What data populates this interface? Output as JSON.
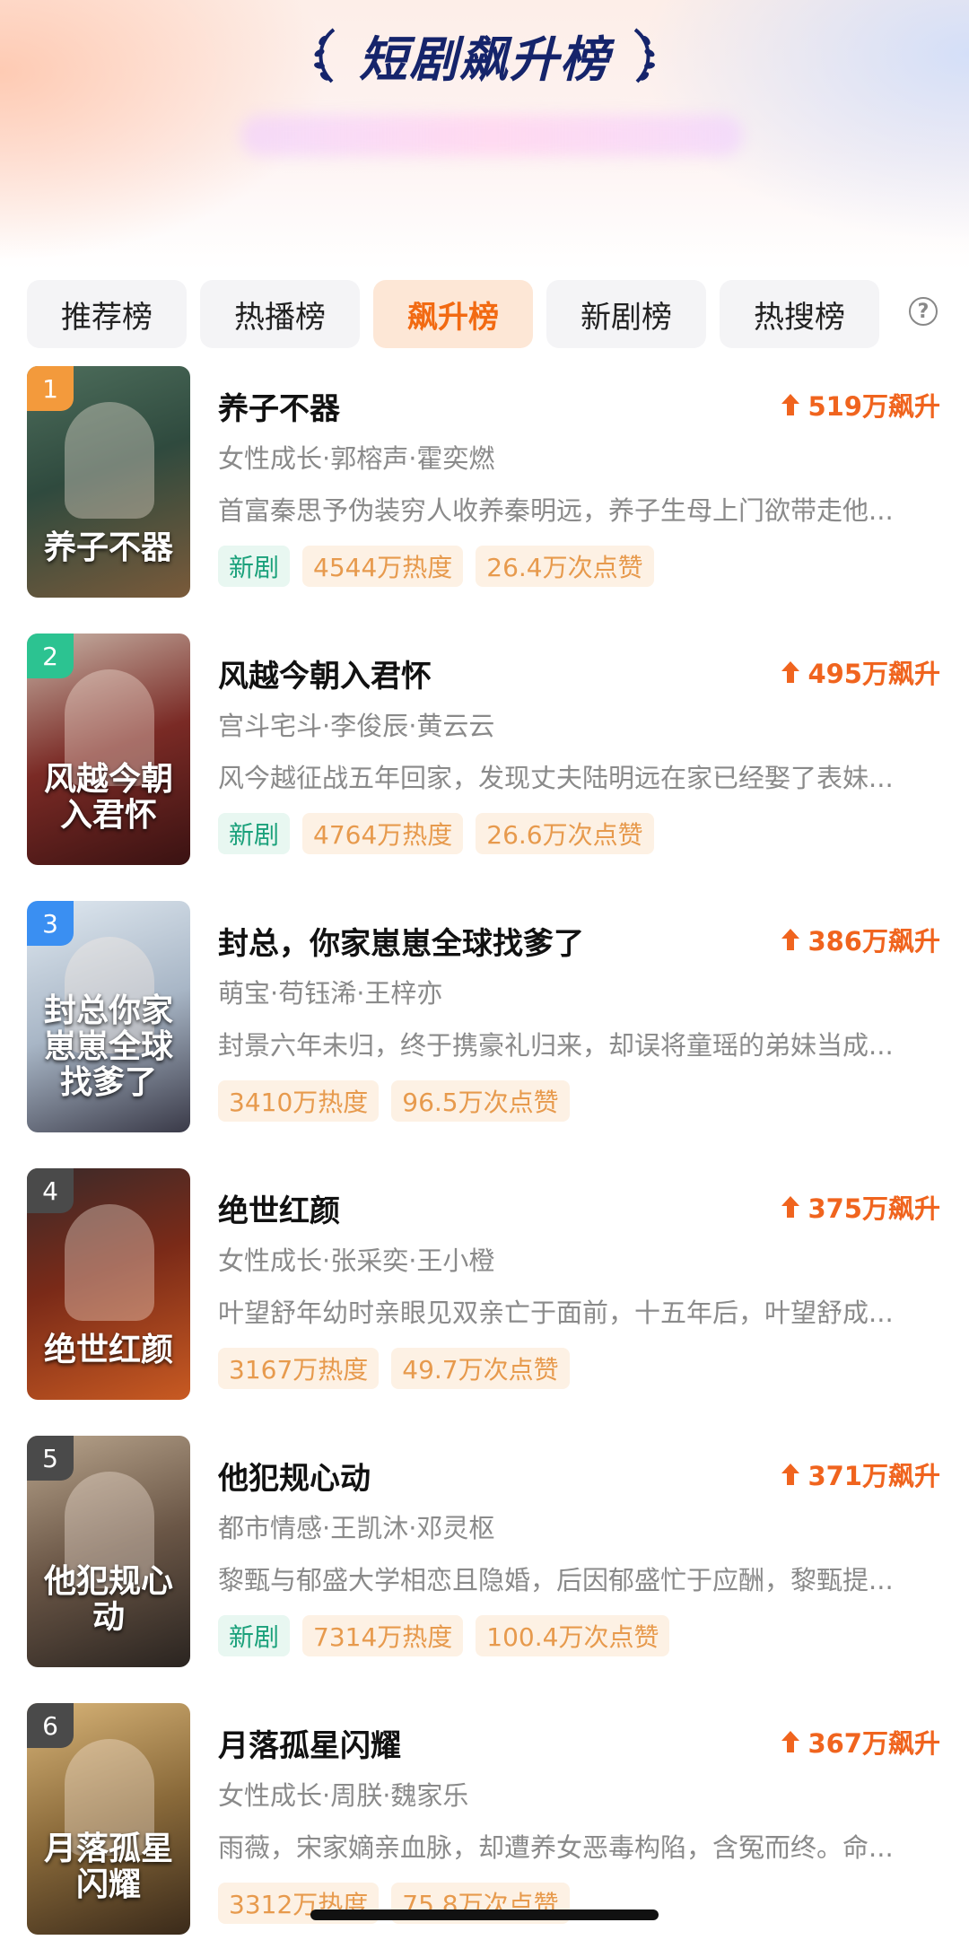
{
  "header": {
    "title": "短剧飙升榜"
  },
  "tabs": [
    {
      "label": "推荐榜",
      "active": false
    },
    {
      "label": "热播榜",
      "active": false
    },
    {
      "label": "飙升榜",
      "active": true
    },
    {
      "label": "新剧榜",
      "active": false
    },
    {
      "label": "热搜榜",
      "active": false
    }
  ],
  "help_icon": {
    "glyph": "?"
  },
  "colors": {
    "accent": "#f26a12",
    "title": "#15246b",
    "rank_1": "#f39a3c",
    "rank_2": "#2cc391",
    "rank_3": "#3a8ff2",
    "rank_other": "#4a4a4a"
  },
  "items": [
    {
      "rank": "1",
      "title": "养子不器",
      "rise": "519万飙升",
      "meta": "女性成长·郭榕声·霍奕燃",
      "desc": "首富秦思予伪装穷人收养秦明远，养子生母上门欲带走他...",
      "tag_new": "新剧",
      "heat": "4544万热度",
      "likes": "26.4万次点赞",
      "cover_text": "养子不器"
    },
    {
      "rank": "2",
      "title": "风越今朝入君怀",
      "rise": "495万飙升",
      "meta": "宫斗宅斗·李俊辰·黄云云",
      "desc": "风今越征战五年回家，发现丈夫陆明远在家已经娶了表妹...",
      "tag_new": "新剧",
      "heat": "4764万热度",
      "likes": "26.6万次点赞",
      "cover_text": "风越今朝入君怀"
    },
    {
      "rank": "3",
      "title": "封总，你家崽崽全球找爹了",
      "rise": "386万飙升",
      "meta": "萌宝·苟钰浠·王梓亦",
      "desc": "封景六年未归，终于携豪礼归来，却误将童瑶的弟妹当成...",
      "tag_new": null,
      "heat": "3410万热度",
      "likes": "96.5万次点赞",
      "cover_text": "封总你家崽崽全球找爹了"
    },
    {
      "rank": "4",
      "title": "绝世红颜",
      "rise": "375万飙升",
      "meta": "女性成长·张采奕·王小橙",
      "desc": "叶望舒年幼时亲眼见双亲亡于面前，十五年后，叶望舒成...",
      "tag_new": null,
      "heat": "3167万热度",
      "likes": "49.7万次点赞",
      "cover_text": "绝世红颜"
    },
    {
      "rank": "5",
      "title": "他犯规心动",
      "rise": "371万飙升",
      "meta": "都市情感·王凯沐·邓灵枢",
      "desc": "黎甄与郁盛大学相恋且隐婚，后因郁盛忙于应酬，黎甄提...",
      "tag_new": "新剧",
      "heat": "7314万热度",
      "likes": "100.4万次点赞",
      "cover_text": "他犯规心动"
    },
    {
      "rank": "6",
      "title": "月落孤星闪耀",
      "rise": "367万飙升",
      "meta": "女性成长·周朕·魏家乐",
      "desc": "雨薇，宋家嫡亲血脉，却遭养女恶毒构陷，含冤而终。命...",
      "tag_new": null,
      "heat": "3312万热度",
      "likes": "75.8万次点赞",
      "cover_text": "月落孤星闪耀"
    }
  ]
}
